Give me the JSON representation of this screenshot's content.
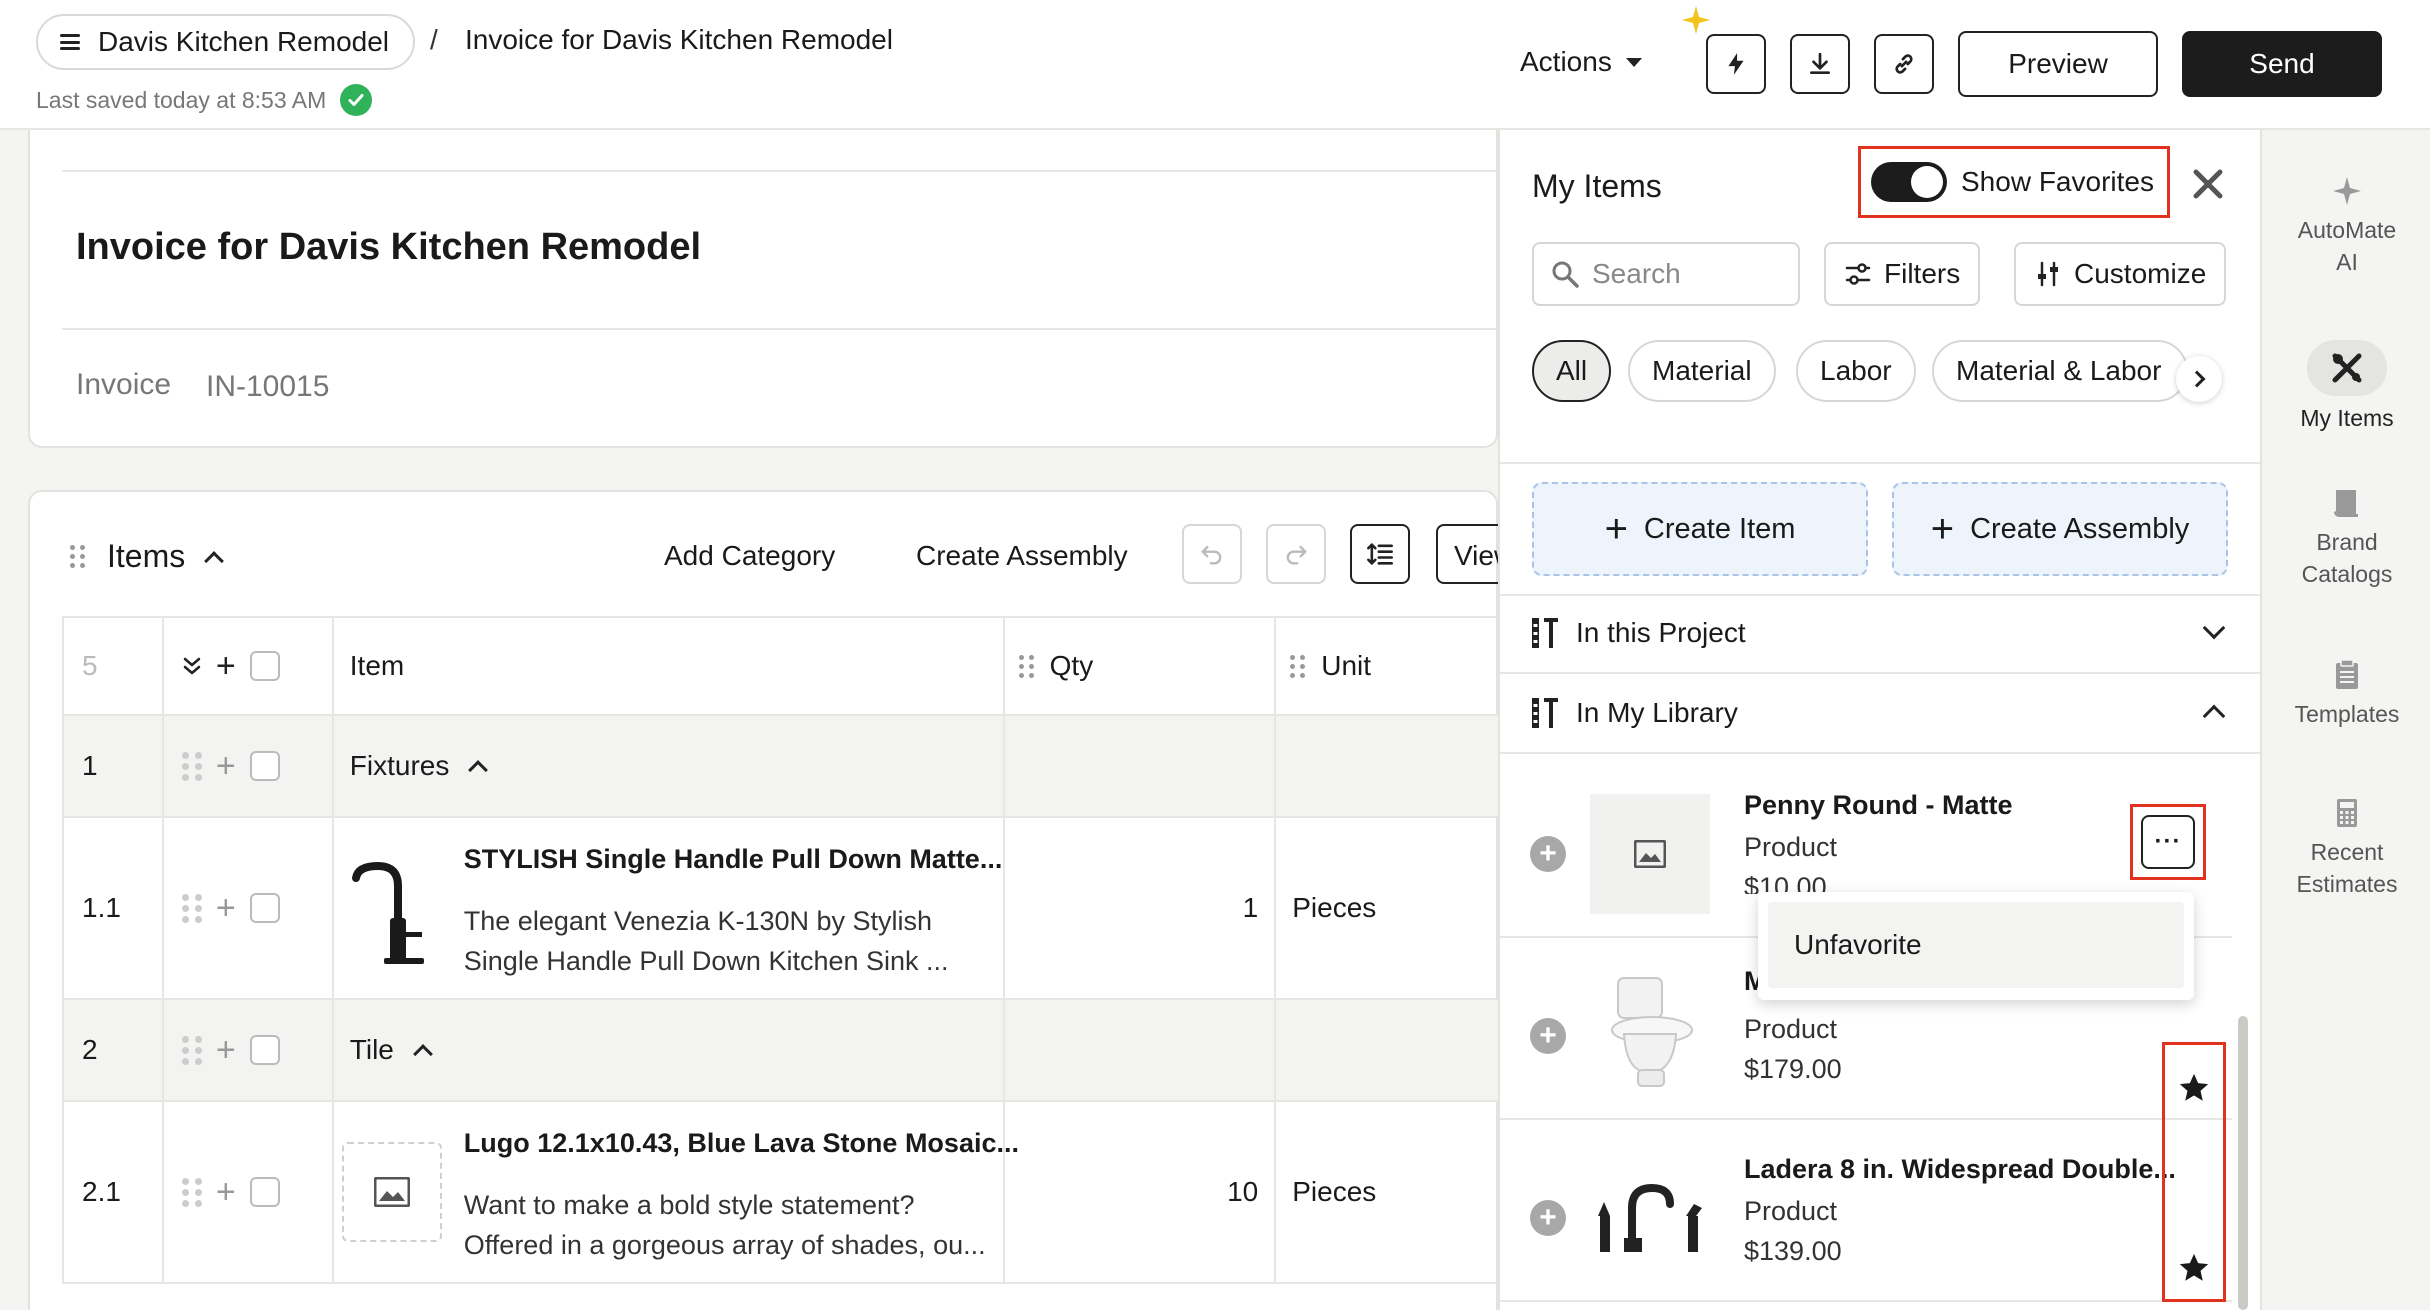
{
  "header": {
    "project_name": "Davis Kitchen Remodel",
    "separator": "/",
    "current_page": "Invoice for Davis Kitchen Remodel",
    "last_saved": "Last saved today at 8:53 AM",
    "actions_label": "Actions",
    "preview_label": "Preview",
    "send_label": "Send"
  },
  "document": {
    "title": "Invoice for Davis Kitchen Remodel",
    "invoice_label": "Invoice",
    "invoice_number": "IN-10015"
  },
  "items_section": {
    "title": "Items",
    "add_category": "Add Category",
    "create_assembly": "Create Assembly",
    "view_label": "View",
    "count": "5",
    "columns": {
      "item": "Item",
      "qty": "Qty",
      "unit": "Unit"
    },
    "rows": [
      {
        "kind": "category",
        "num": "1",
        "name": "Fixtures"
      },
      {
        "kind": "item",
        "num": "1.1",
        "name": "STYLISH Single Handle Pull Down Matte...",
        "desc_line1": "The elegant Venezia K-130N by Stylish",
        "desc_line2": "Single Handle Pull Down Kitchen Sink ...",
        "qty": "1",
        "unit": "Pieces",
        "thumb": "faucet-icon"
      },
      {
        "kind": "category",
        "num": "2",
        "name": "Tile"
      },
      {
        "kind": "item",
        "num": "2.1",
        "name": "Lugo 12.1x10.43, Blue Lava Stone Mosaic...",
        "desc_line1": "Want to make a bold style statement?",
        "desc_line2": "Offered in a gorgeous array of shades, ou...",
        "qty": "10",
        "unit": "Pieces",
        "thumb": "image-placeholder-icon"
      }
    ]
  },
  "panel": {
    "title": "My Items",
    "show_favorites_label": "Show Favorites",
    "show_favorites_on": true,
    "search_placeholder": "Search",
    "filters_label": "Filters",
    "customize_label": "Customize",
    "chips": [
      "All",
      "Material",
      "Labor",
      "Material & Labor"
    ],
    "active_chip": "All",
    "create_item": "Create Item",
    "create_assembly": "Create Assembly",
    "section_project": "In this Project",
    "section_library": "In My Library",
    "library_items": [
      {
        "name": "Penny Round - Matte",
        "type": "Product",
        "price": "$10.00",
        "thumb": "image-placeholder-icon"
      },
      {
        "name": "M",
        "type": "Product",
        "price": "$179.00",
        "thumb": "toilet-icon"
      },
      {
        "name": "Ladera 8 in. Widespread Double...",
        "type": "Product",
        "price": "$139.00",
        "thumb": "widespread-faucet-icon"
      }
    ],
    "menu_item": "Unfavorite"
  },
  "rail": {
    "items": [
      {
        "line1": "AutoMate",
        "line2": "AI",
        "icon": "sparkle-icon"
      },
      {
        "line1": "My Items",
        "line2": "",
        "icon": "tools-icon"
      },
      {
        "line1": "Brand",
        "line2": "Catalogs",
        "icon": "book-icon"
      },
      {
        "line1": "Templates",
        "line2": "",
        "icon": "clipboard-icon"
      },
      {
        "line1": "Recent",
        "line2": "Estimates",
        "icon": "calculator-icon"
      }
    ]
  },
  "colors": {
    "accent_dark": "#1c1c1c",
    "highlight_red": "#e0321f",
    "saved_green": "#2fb25a",
    "create_bg": "#eef4fb"
  }
}
